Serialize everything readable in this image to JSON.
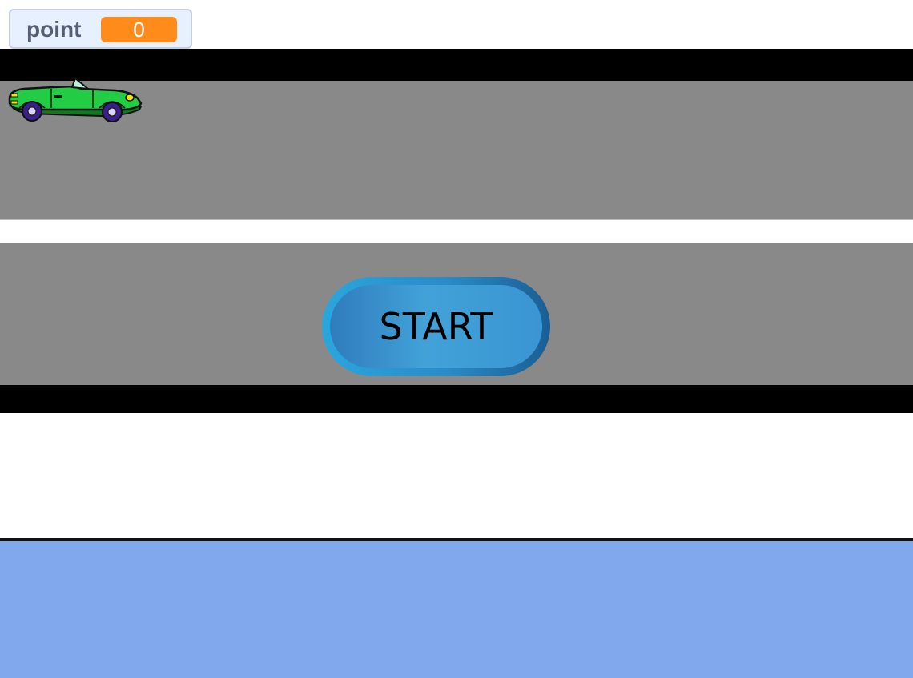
{
  "hud": {
    "score_label": "point",
    "score_value": "0",
    "score_value_color": "#ff8c1a"
  },
  "sprites": {
    "player_car": {
      "icon": "green-convertible-car-icon",
      "color": "#22cc44"
    }
  },
  "start_button": {
    "label": "START",
    "color": "#3a93d1"
  },
  "scene": {
    "road_color": "#898989",
    "edge_color": "#000000",
    "water_color": "#81a8ec"
  }
}
